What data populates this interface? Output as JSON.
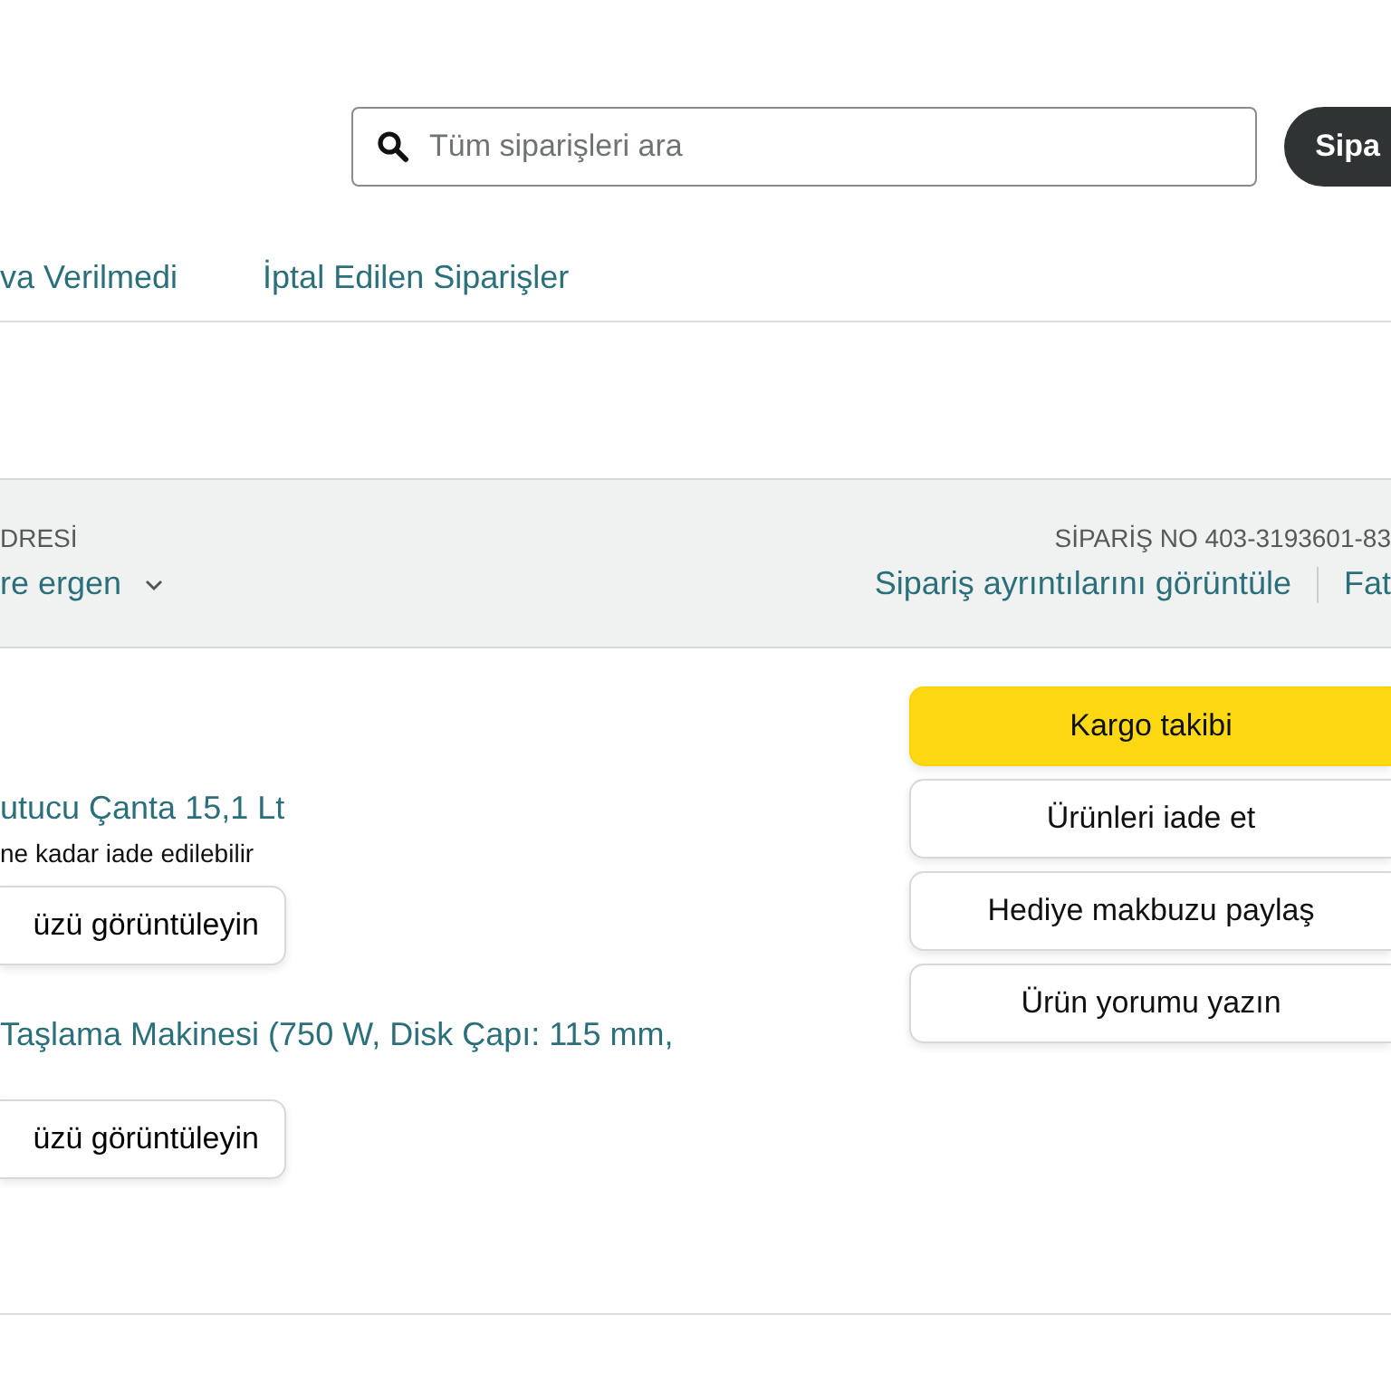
{
  "search": {
    "placeholder": "Tüm siparişleri ara"
  },
  "search_button": {
    "label": "Sipa"
  },
  "tabs": [
    {
      "label": "va Verilmedi",
      "selected": false
    },
    {
      "label": "İptal Edilen Siparişler",
      "selected": false
    }
  ],
  "order_header": {
    "column_1": {
      "heading": "DRESİ",
      "value": "re ergen"
    },
    "order_number": "SİPARİŞ NO 403-3193601-83",
    "links": [
      "Sipariş ayrıntılarını görüntüle",
      "Fat"
    ]
  },
  "items": [
    {
      "title": "utucu Çanta 15,1 Lt",
      "note": "ne kadar iade edilebilir",
      "button": "üzü görüntüleyin"
    },
    {
      "title": "Taşlama Makinesi (750 W, Disk Çapı: 115 mm,",
      "button": "üzü görüntüleyin"
    }
  ],
  "actions": [
    {
      "label": "Kargo takibi",
      "kind": "primary"
    },
    {
      "label": "Ürünleri iade et",
      "kind": "secondary"
    },
    {
      "label": "Hediye makbuzu paylaş",
      "kind": "secondary"
    },
    {
      "label": "Ürün yorumu yazın",
      "kind": "secondary"
    }
  ]
}
